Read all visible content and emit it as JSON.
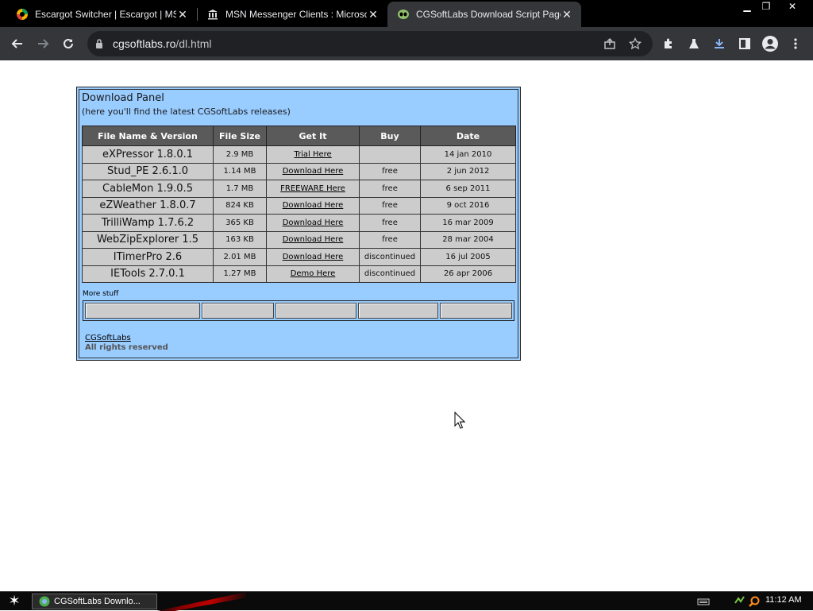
{
  "browser": {
    "tabs": [
      {
        "title": "Escargot Switcher | Escargot | MSN",
        "icon": "escargot-favicon"
      },
      {
        "title": "MSN Messenger Clients : Microsoft",
        "icon": "museum-favicon"
      },
      {
        "title": "CGSoftLabs Download Script Page",
        "icon": "cgsoftlabs-favicon",
        "active": true
      }
    ],
    "url_host": "cgsoftlabs.ro",
    "url_path": "/dl.html"
  },
  "panel": {
    "title": "Download Panel",
    "subtitle": "(here you'll find the latest CGSoftLabs releases)",
    "columns": [
      "File Name & Version",
      "File Size",
      "Get It",
      "Buy",
      "Date"
    ],
    "rows": [
      {
        "name": "eXPressor 1.8.0.1",
        "size": "2.9 MB",
        "get": "Trial Here",
        "buy": "",
        "date": "14 jan 2010"
      },
      {
        "name": "Stud_PE 2.6.1.0",
        "size": "1.14 MB",
        "get": "Download Here",
        "buy": "free",
        "date": "2 jun 2012"
      },
      {
        "name": "CableMon 1.9.0.5",
        "size": "1.7 MB",
        "get": "FREEWARE Here",
        "buy": "free",
        "date": "6 sep 2011"
      },
      {
        "name": "eZWeather 1.8.0.7",
        "size": "824 KB",
        "get": "Download Here",
        "buy": "free",
        "date": "9 oct 2016"
      },
      {
        "name": "TrilliWamp 1.7.6.2",
        "size": "365 KB",
        "get": "Download Here",
        "buy": "free",
        "date": "16 mar 2009"
      },
      {
        "name": "WebZipExplorer 1.5",
        "size": "163 KB",
        "get": "Download Here",
        "buy": "free",
        "date": "28 mar 2004"
      },
      {
        "name": "ITimerPro 2.6",
        "size": "2.01 MB",
        "get": "Download Here",
        "buy": "discontinued",
        "date": "16 jul 2005"
      },
      {
        "name": "IETools 2.7.0.1",
        "size": "1.27 MB",
        "get": "Demo Here",
        "buy": "discontinued",
        "date": "26 apr 2006"
      }
    ],
    "more_label": "More stuff",
    "footer_link": "CGSoftLabs",
    "footer_note": "All rights reserved"
  },
  "taskbar": {
    "window_title": "CGSoftLabs Downlo...",
    "clock": "11:12 AM"
  },
  "colors": {
    "panel_bg": "#99ccff",
    "header_bg": "#5a5a5a",
    "cell_bg": "#cccccc",
    "chrome_dark": "#35363a"
  }
}
